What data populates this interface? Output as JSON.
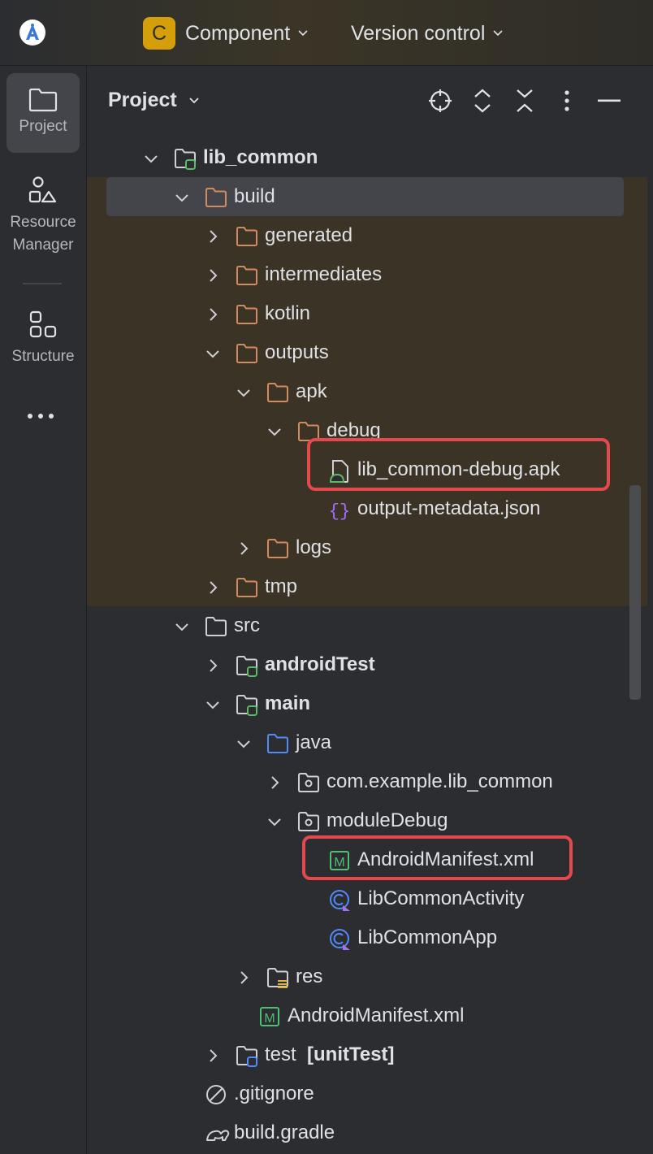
{
  "titlebar": {
    "project_badge": "C",
    "project_name": "Component",
    "vcs_label": "Version control"
  },
  "toolstrip": {
    "items": [
      {
        "label": "Project",
        "icon": "folder-icon"
      },
      {
        "label": "Resource Manager",
        "icon": "resource-manager-icon"
      },
      {
        "label": "Structure",
        "icon": "structure-icon"
      }
    ],
    "more": "more-icon"
  },
  "panel": {
    "title": "Project"
  },
  "tree": {
    "lib_common": "lib_common",
    "build": "build",
    "generated": "generated",
    "intermediates": "intermediates",
    "kotlin": "kotlin",
    "outputs": "outputs",
    "apk": "apk",
    "debug": "debug",
    "apk_file": "lib_common-debug.apk",
    "metadata_file": "output-metadata.json",
    "logs": "logs",
    "tmp": "tmp",
    "src": "src",
    "androidTest": "androidTest",
    "main": "main",
    "java": "java",
    "package": "com.example.lib_common",
    "moduleDebug": "moduleDebug",
    "manifest_module": "AndroidManifest.xml",
    "activity": "LibCommonActivity",
    "app": "LibCommonApp",
    "res": "res",
    "manifest_main": "AndroidManifest.xml",
    "test": "test",
    "test_suffix": "[unitTest]",
    "gitignore": ".gitignore",
    "build_gradle": "build.gradle"
  },
  "colors": {
    "background": "#2b2d30",
    "selection": "#43454a",
    "excluded_bg": "#3b3325",
    "highlight": "#e5484d",
    "folder_orange": "#d28a5f",
    "folder_blue": "#548af7",
    "module_green": "#5fb865",
    "manifest_green": "#4fbf73",
    "json_purple": "#a371f7"
  }
}
